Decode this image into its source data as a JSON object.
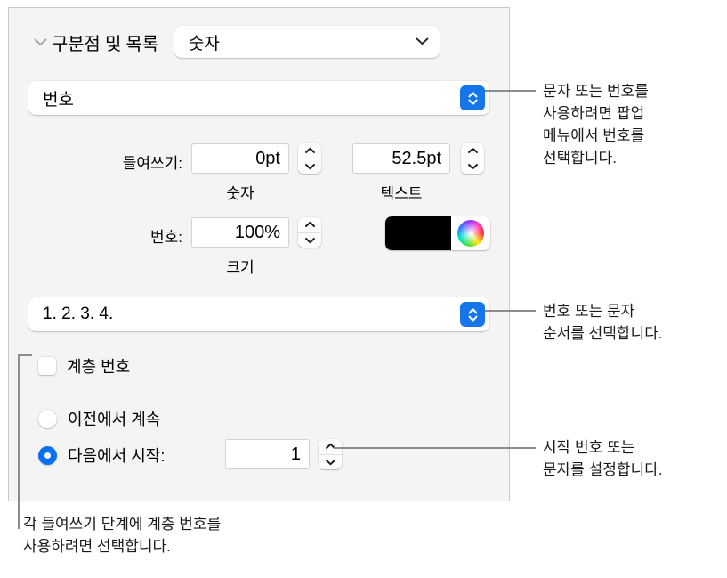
{
  "panel": {
    "section": {
      "disclosure_icon": "chevron-down-icon",
      "title": "구분점 및 목록",
      "style_popup": {
        "value": "숫자",
        "icon": "chevron-down-icon"
      }
    },
    "bullet_type": {
      "value": "번호",
      "stepper_icon": "up-down-chevron-icon"
    },
    "indent": {
      "label": "들여쓰기:",
      "number": {
        "value": "0pt",
        "sub_label": "숫자",
        "stepper_icon": "stepper-up-down-icon"
      },
      "text": {
        "value": "52.5pt",
        "sub_label": "텍스트",
        "stepper_icon": "stepper-up-down-icon"
      }
    },
    "number_size": {
      "label": "번호:",
      "value": "100%",
      "sub_label": "크기",
      "stepper_icon": "stepper-up-down-icon",
      "color": {
        "swatch_hex": "#000000",
        "wheel_icon": "color-wheel-icon"
      }
    },
    "number_format": {
      "value": "1. 2. 3. 4.",
      "stepper_icon": "up-down-chevron-icon"
    },
    "tiered_numbers": {
      "label": "계층 번호",
      "checked": false
    },
    "continuation": {
      "continue_option": {
        "label": "이전에서 계속",
        "selected": false
      },
      "start_at_option": {
        "label": "다음에서 시작:",
        "selected": true,
        "value": "1",
        "stepper_icon": "stepper-up-down-icon"
      }
    }
  },
  "callouts": {
    "popup_menu": "문자 또는 번호를\n사용하려면 팝업\n메뉴에서 번호를\n선택합니다.",
    "number_order": "번호 또는 문자\n순서를 선택합니다.",
    "start_number": "시작 번호 또는\n문자를 설정합니다.",
    "tiered": "각 들여쓰기 단계에 계층 번호를\n사용하려면 선택합니다."
  }
}
